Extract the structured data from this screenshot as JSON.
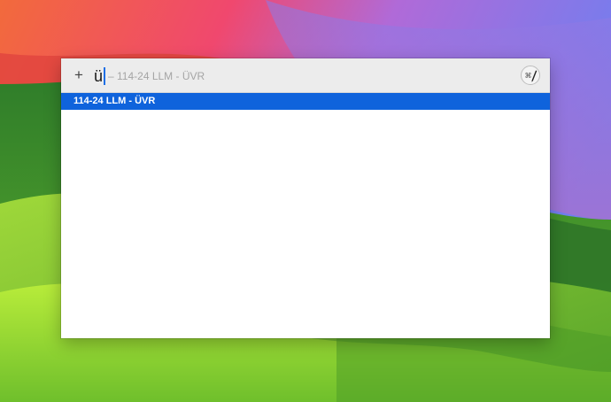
{
  "search": {
    "add_label": "+",
    "query": "ü",
    "completion": "– 114-24 LLM - ÜVR",
    "app_icon": "shortcut-key-icon"
  },
  "results": {
    "items": [
      {
        "label": "114-24 LLM - ÜVR",
        "selected": true
      }
    ]
  },
  "colors": {
    "selection": "#0f63dc",
    "caret": "#1f6fe5",
    "bar_background": "#ececec"
  }
}
